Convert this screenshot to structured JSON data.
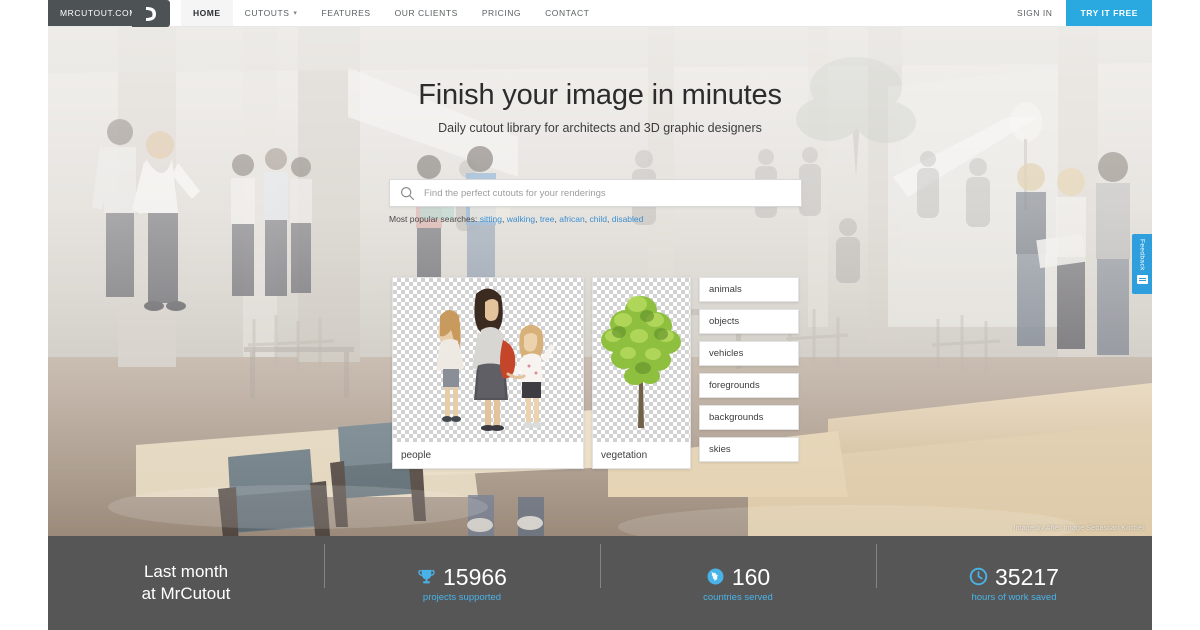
{
  "nav": {
    "logo_text": "MRCUTOUT.COM",
    "logo_icon": "mask-face-icon",
    "items": [
      {
        "label": "HOME",
        "active": true,
        "caret": false
      },
      {
        "label": "CUTOUTS",
        "active": false,
        "caret": true
      },
      {
        "label": "FEATURES",
        "active": false,
        "caret": false
      },
      {
        "label": "OUR CLIENTS",
        "active": false,
        "caret": false
      },
      {
        "label": "PRICING",
        "active": false,
        "caret": false
      },
      {
        "label": "CONTACT",
        "active": false,
        "caret": false
      }
    ],
    "sign_in": "SIGN IN",
    "try_free": "TRY IT FREE",
    "accent_color": "#29a9e0"
  },
  "hero": {
    "headline": "Finish your image in minutes",
    "subhead": "Daily cutout library for architects and 3D graphic designers",
    "credit": "Image by After Image Sebastian Kochel"
  },
  "search": {
    "placeholder": "Find the perfect cutouts for your renderings",
    "value": "",
    "icon": "search-icon",
    "popular_label": "Most popular searches:",
    "popular_terms": [
      "sitting",
      "walking",
      "tree",
      "african",
      "child",
      "disabled"
    ],
    "link_color": "#3b8fd1"
  },
  "cards": [
    {
      "label": "people",
      "thumb": "three-women-walking-cutout"
    },
    {
      "label": "vegetation",
      "thumb": "green-tree-cutout"
    }
  ],
  "categories": [
    {
      "label": "animals"
    },
    {
      "label": "objects"
    },
    {
      "label": "vehicles"
    },
    {
      "label": "foregrounds"
    },
    {
      "label": "backgrounds"
    },
    {
      "label": "skies"
    }
  ],
  "feedback": {
    "label": "Feedback",
    "icon": "comment-box-icon",
    "color": "#2e9fdc"
  },
  "stats": {
    "background": "#565656",
    "value_color": "#49b3e8",
    "lead_line1": "Last month",
    "lead_line2": "at MrCutout",
    "items": [
      {
        "icon": "trophy-icon",
        "value": "15966",
        "label": "projects supported"
      },
      {
        "icon": "globe-icon",
        "value": "160",
        "label": "countries served"
      },
      {
        "icon": "clock-icon",
        "value": "35217",
        "label": "hours of work saved"
      }
    ]
  }
}
